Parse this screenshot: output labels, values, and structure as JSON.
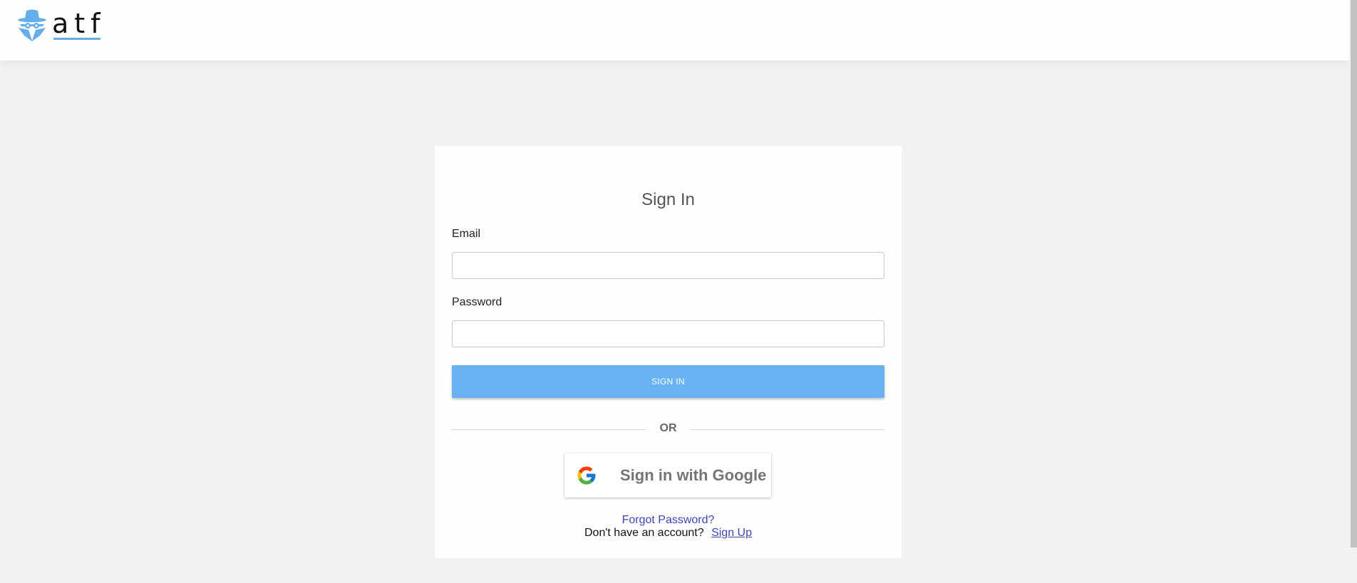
{
  "header": {
    "logo_text": "atf",
    "logo_icon": "spy-hat-icon",
    "accent_color": "#64aee9"
  },
  "signin": {
    "title": "Sign In",
    "email_label": "Email",
    "email_value": "",
    "password_label": "Password",
    "password_value": "",
    "submit_label": "SIGN IN",
    "divider_label": "OR",
    "google_label": "Sign in with Google",
    "google_icon": "google-g-icon",
    "forgot_label": "Forgot Password?",
    "no_account_label": "Don't have an account?",
    "signup_label": "Sign Up",
    "button_color": "#69b3f5",
    "link_color": "#3e45b5"
  }
}
